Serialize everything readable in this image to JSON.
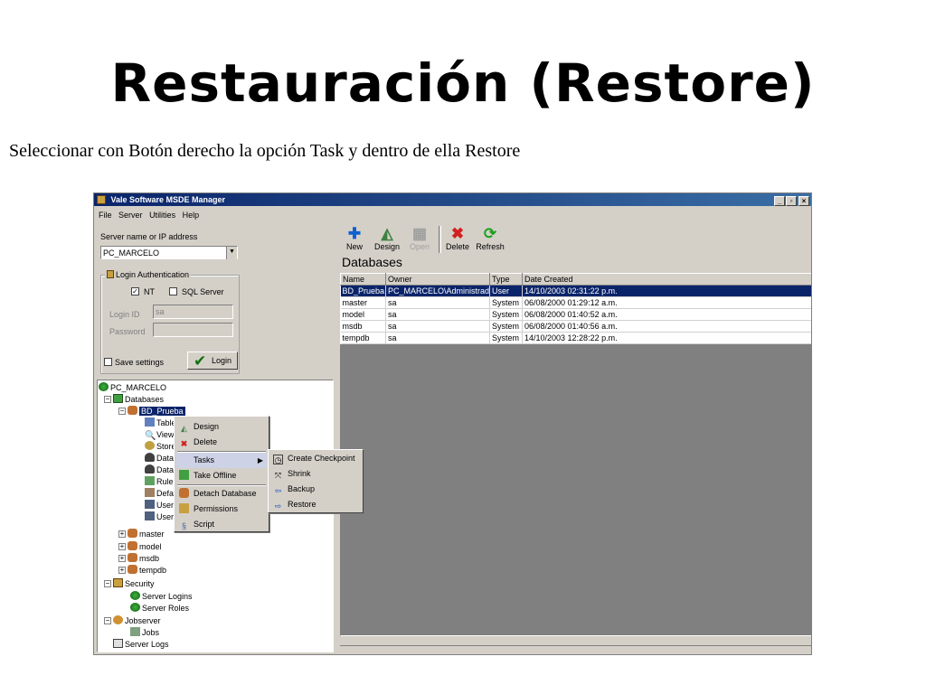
{
  "slide": {
    "title": "Restauración (Restore)",
    "subtitle": "Seleccionar con Botón derecho la opción Task y dentro de ella Restore"
  },
  "window": {
    "title": "Vale Software MSDE Manager",
    "controls": [
      "_",
      "▫",
      "×"
    ]
  },
  "menu": [
    "File",
    "Server",
    "Utilities",
    "Help"
  ],
  "login": {
    "server_label": "Server name or IP address",
    "server_value": "PC_MARCELO",
    "auth_legend": "Login Authentication",
    "nt_label": "NT",
    "nt_checked": true,
    "sql_label": "SQL Server",
    "sql_checked": false,
    "login_id_label": "Login ID",
    "login_id_value": "sa",
    "password_label": "Password",
    "password_value": "",
    "save_settings_label": "Save settings",
    "login_button": "Login"
  },
  "tree": {
    "root": "PC_MARCELO",
    "databases": "Databases",
    "selected_db": "BD_Prueba",
    "children_partial": [
      "Table",
      "Views",
      "Store",
      "Data",
      "Data",
      "Rules",
      "Defa",
      "User",
      "User"
    ],
    "other_dbs": [
      "master",
      "model",
      "msdb",
      "tempdb"
    ],
    "security": "Security",
    "security_children": [
      "Server Logins",
      "Server Roles"
    ],
    "jobserver": "Jobserver",
    "jobserver_children": [
      "Jobs"
    ],
    "server_logs": "Server Logs"
  },
  "toolbar": [
    {
      "label": "New",
      "icon": "plus-icon",
      "enabled": true
    },
    {
      "label": "Design",
      "icon": "design-icon",
      "enabled": true
    },
    {
      "label": "Open",
      "icon": "open-icon",
      "enabled": false
    },
    {
      "label": "Delete",
      "icon": "delete-x-icon",
      "enabled": true
    },
    {
      "label": "Refresh",
      "icon": "refresh-icon",
      "enabled": true
    }
  ],
  "databases_heading": "Databases",
  "grid": {
    "columns": [
      "Name",
      "Owner",
      "Type",
      "Date Created"
    ],
    "rows": [
      [
        "BD_Prueba",
        "PC_MARCELO\\Administrador",
        "User",
        "14/10/2003 02:31:22 p.m."
      ],
      [
        "master",
        "sa",
        "System",
        "06/08/2000 01:29:12 a.m."
      ],
      [
        "model",
        "sa",
        "System",
        "06/08/2000 01:40:52 a.m."
      ],
      [
        "msdb",
        "sa",
        "System",
        "06/08/2000 01:40:56 a.m."
      ],
      [
        "tempdb",
        "sa",
        "System",
        "14/10/2003 12:28:22 p.m."
      ]
    ],
    "selected_row": 0
  },
  "context_menu": {
    "items": [
      "Design",
      "Delete",
      "Tasks",
      "Take Offline",
      "Detach Database",
      "Permissions",
      "Script"
    ],
    "highlighted": "Tasks"
  },
  "tasks_submenu": {
    "items": [
      "Create Checkpoint",
      "Shrink",
      "Backup",
      "Restore"
    ]
  },
  "colors": {
    "title_bar": "#0a246a",
    "face": "#d4d0c8",
    "selection": "#0a246a",
    "grid_empty": "#808080"
  }
}
